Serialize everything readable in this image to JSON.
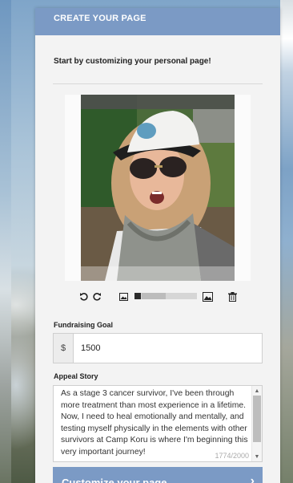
{
  "header": {
    "title": "CREATE YOUR PAGE"
  },
  "intro": {
    "text": "Start by customizing your personal page!"
  },
  "photo_tools": {
    "rotate_left_icon": "rotate-left-icon",
    "rotate_right_icon": "rotate-right-icon",
    "zoom_out_icon": "image-small-icon",
    "zoom_in_icon": "image-large-icon",
    "delete_icon": "trash-icon",
    "zoom_level": 0.1
  },
  "goal": {
    "label": "Fundraising Goal",
    "currency_symbol": "$",
    "value": "1500"
  },
  "story": {
    "label": "Appeal Story",
    "text": "As a stage 3 cancer survivor, I've been through more treatment than most experience in a lifetime.  Now, I need to heal emotionally and mentally, and testing myself physically in the elements with other survivors at Camp Koru is where I'm beginning this very important journey!",
    "char_count": "1774/2000"
  },
  "cta": {
    "label": "Customize your page",
    "arrow": "›"
  },
  "colors": {
    "accent": "#7b9ac5",
    "panel": "#f3f3f3"
  }
}
